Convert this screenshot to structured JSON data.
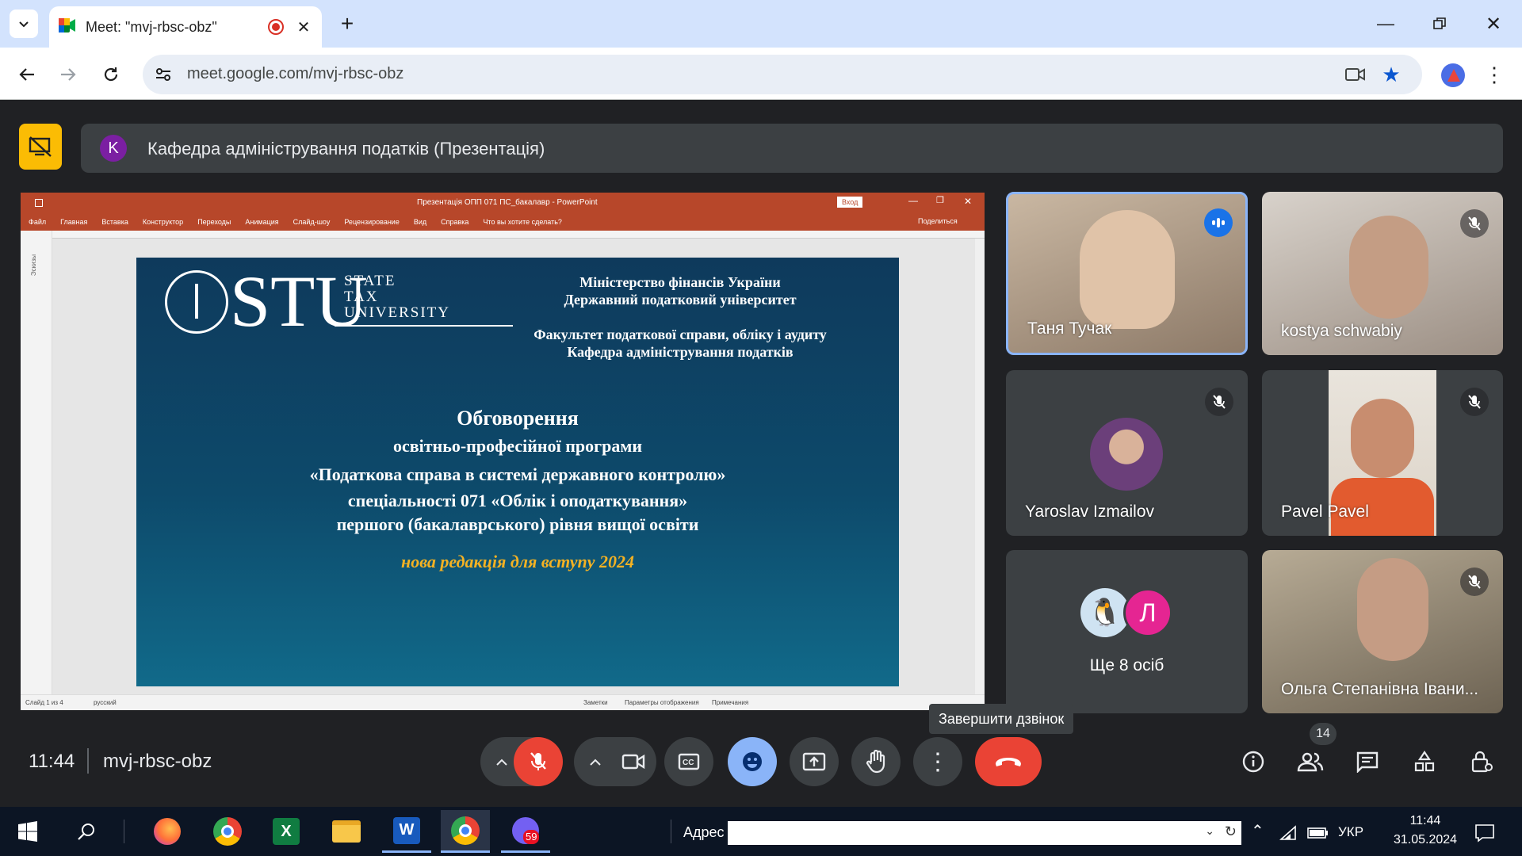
{
  "browser": {
    "tab_title": "Meet: \"mvj-rbsc-obz\"",
    "url": "meet.google.com/mvj-rbsc-obz"
  },
  "meeting": {
    "presenter_initial": "K",
    "presentation_title": "Кафедра адміністрування податків (Презентація)",
    "time": "11:44",
    "code": "mvj-rbsc-obz",
    "end_call_tooltip": "Завершити дзвінок",
    "participants_count": "14"
  },
  "powerpoint": {
    "window_title": "Презентація ОПП 071 ПС_бакалавр - PowerPoint",
    "signin": "Вход",
    "menu": [
      "Файл",
      "Главная",
      "Вставка",
      "Конструктор",
      "Переходы",
      "Анимация",
      "Слайд-шоу",
      "Рецензирование",
      "Вид",
      "Справка"
    ],
    "tell_me": "Что вы хотите сделать?",
    "share": "Поделиться",
    "status_slide": "Слайд 1 из 4",
    "status_lang": "русский",
    "status_notes": "Заметки",
    "status_display": "Параметры отображения",
    "status_comments": "Примечания",
    "side_label": "Эскизы"
  },
  "slide": {
    "logo_text": "STU",
    "logo_sub": [
      "STATE",
      "TAX",
      "UNIVERSITY"
    ],
    "ministry": "Міністерство фінансів України",
    "university": "Державний податковий університет",
    "faculty": "Факультет податкової справи, обліку і аудиту",
    "department": "Кафедра адміністрування податків",
    "heading": "Обговорення",
    "lines": [
      "освітньо-професійної програми",
      "«Податкова справа в системі державного контролю»",
      "спеціальності 071 «Облік і оподаткування»",
      "першого (бакалаврського) рівня вищої освіти"
    ],
    "tagline": "нова редакція для вступу 2024"
  },
  "participants": [
    {
      "name": "Таня Тучак",
      "state": "speaking"
    },
    {
      "name": "kostya schwabiy",
      "state": "muted"
    },
    {
      "name": "Yaroslav Izmailov",
      "state": "muted"
    },
    {
      "name": "Pavel Pavel",
      "state": "muted"
    },
    {
      "name": "Ще 8 осіб",
      "avatar_letter": "Л"
    },
    {
      "name": "Ольга Степанівна Івани...",
      "state": "muted"
    }
  ],
  "taskbar": {
    "address_label": "Адрес",
    "lang": "УКР",
    "time": "11:44",
    "date": "31.05.2024",
    "viber_badge": "59"
  },
  "colors": {
    "accent": "#8ab4f8",
    "end_call": "#ea4335",
    "ppt_orange": "#b7472a",
    "slide_blue": "#0d4a6b",
    "tagline": "#f4b223"
  }
}
